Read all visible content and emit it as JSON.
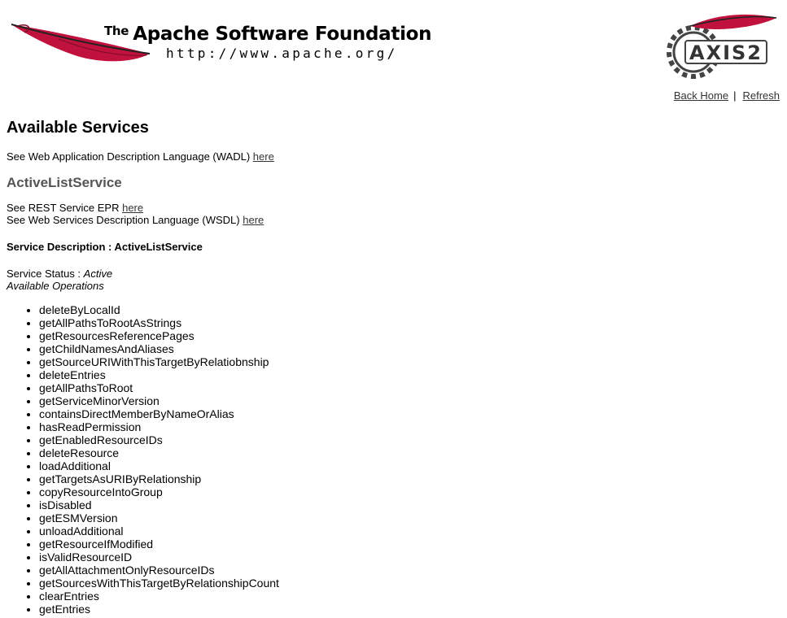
{
  "header": {
    "apache_title_the": "The",
    "apache_title": "Apache Software Foundation",
    "apache_url": "http://www.apache.org/",
    "axis_logo_text": "AXIS2",
    "colors": {
      "feather_red": "#c0123c",
      "feather_dark": "#7a0c28",
      "gear": "#444444"
    }
  },
  "nav": {
    "back_home": "Back Home",
    "separator": "|",
    "refresh": "Refresh"
  },
  "main": {
    "page_title": "Available Services",
    "wadl_text": "See Web Application Description Language (WADL) ",
    "wadl_link": "here",
    "service_name": "ActiveListService",
    "rest_text": "See REST Service EPR ",
    "rest_link": "here",
    "wsdl_text": "See Web Services Description Language (WSDL) ",
    "wsdl_link": "here",
    "service_desc_label": "Service Description : ActiveListService",
    "status_label": "Service Status : ",
    "status_value": "Active",
    "operations_label": "Available Operations",
    "operations": [
      "deleteByLocalId",
      "getAllPathsToRootAsStrings",
      "getResourcesReferencePages",
      "getChildNamesAndAliases",
      "getSourceURIWithThisTargetByRelatiobnship",
      "deleteEntries",
      "getAllPathsToRoot",
      "getServiceMinorVersion",
      "containsDirectMemberByNameOrAlias",
      "hasReadPermission",
      "getEnabledResourceIDs",
      "deleteResource",
      "loadAdditional",
      "getTargetsAsURIByRelationship",
      "copyResourceIntoGroup",
      "isDisabled",
      "getESMVersion",
      "unloadAdditional",
      "getResourceIfModified",
      "isValidResourceID",
      "getAllAttachmentOnlyResourceIDs",
      "getSourcesWithThisTargetByRelationshipCount",
      "clearEntries",
      "getEntries"
    ]
  }
}
